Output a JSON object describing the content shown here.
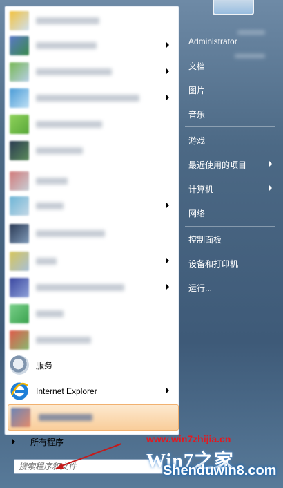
{
  "left_pane": {
    "programs": [
      {
        "icon": "blurred-app-icon",
        "has_submenu": false
      },
      {
        "icon": "blurred-app-icon",
        "has_submenu": true
      },
      {
        "icon": "blurred-app-icon",
        "has_submenu": true
      },
      {
        "icon": "blurred-app-icon",
        "has_submenu": true
      },
      {
        "icon": "blurred-app-icon",
        "has_submenu": false
      },
      {
        "icon": "blurred-app-icon",
        "has_submenu": false
      },
      {
        "icon": "blurred-app-icon",
        "has_submenu": false
      },
      {
        "icon": "blurred-app-icon",
        "has_submenu": true
      },
      {
        "icon": "blurred-app-icon",
        "has_submenu": false
      },
      {
        "icon": "blurred-app-icon",
        "has_submenu": true
      },
      {
        "icon": "blurred-app-icon",
        "has_submenu": true
      },
      {
        "icon": "blurred-app-icon",
        "has_submenu": false
      },
      {
        "icon": "blurred-app-icon",
        "has_submenu": false
      }
    ],
    "services_label": "服务",
    "ie_label": "Internet Explorer",
    "all_programs_label": "所有程序",
    "search_placeholder": "搜索程序和文件"
  },
  "right_pane": {
    "items": [
      {
        "label": "Administrator",
        "has_submenu": false
      },
      {
        "label": "文档",
        "has_submenu": false
      },
      {
        "label": "图片",
        "has_submenu": false
      },
      {
        "label": "音乐",
        "has_submenu": false
      },
      {
        "label": "游戏",
        "has_submenu": false
      },
      {
        "label": "最近使用的项目",
        "has_submenu": true
      },
      {
        "label": "计算机",
        "has_submenu": true
      },
      {
        "label": "网络",
        "has_submenu": false
      },
      {
        "label": "控制面板",
        "has_submenu": false
      },
      {
        "label": "设备和打印机",
        "has_submenu": false
      },
      {
        "label": "运行...",
        "has_submenu": false
      }
    ]
  },
  "watermark": {
    "url": "www.win7zhijia.cn",
    "logo": "Win7之家",
    "site": "Shenduwin8.com"
  },
  "colors": {
    "highlight": "#f9cd9a",
    "watermark_red": "#e3191f"
  }
}
